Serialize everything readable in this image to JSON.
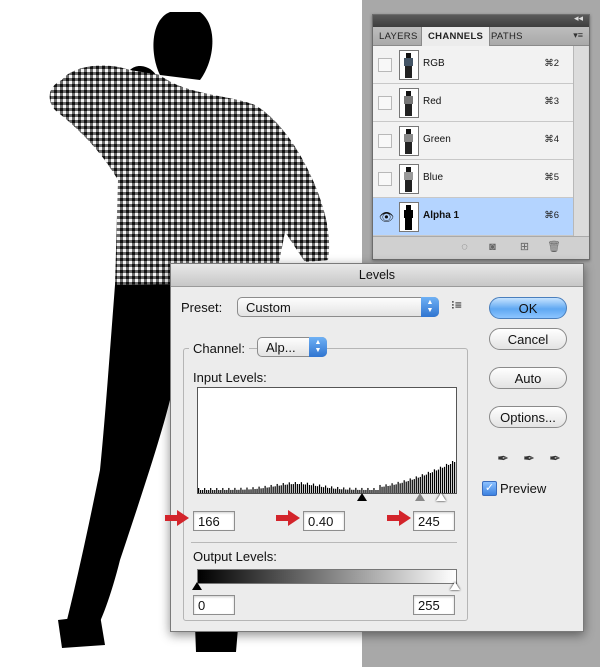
{
  "channels_panel": {
    "tabs": [
      "LAYERS",
      "CHANNELS",
      "PATHS"
    ],
    "active_tab": "CHANNELS",
    "rows": [
      {
        "name": "RGB",
        "shortcut": "⌘2",
        "visible": false,
        "selected": false
      },
      {
        "name": "Red",
        "shortcut": "⌘3",
        "visible": false,
        "selected": false
      },
      {
        "name": "Green",
        "shortcut": "⌘4",
        "visible": false,
        "selected": false
      },
      {
        "name": "Blue",
        "shortcut": "⌘5",
        "visible": false,
        "selected": false
      },
      {
        "name": "Alpha 1",
        "shortcut": "⌘6",
        "visible": true,
        "selected": true
      }
    ],
    "bottom_icons": [
      "dotted-circle-icon",
      "mask-icon",
      "new-channel-icon",
      "trash-icon"
    ]
  },
  "levels": {
    "title": "Levels",
    "preset_label": "Preset:",
    "preset_value": "Custom",
    "channel_label": "Channel:",
    "channel_value": "Alp...",
    "input_levels_label": "Input Levels:",
    "input_black": "166",
    "input_gamma": "0.40",
    "input_white": "245",
    "output_levels_label": "Output Levels:",
    "output_black": "0",
    "output_white": "255",
    "buttons": {
      "ok": "OK",
      "cancel": "Cancel",
      "auto": "Auto",
      "options": "Options..."
    },
    "preview_label": "Preview",
    "preview_checked": true,
    "histogram_max_level": 255
  },
  "colors": {
    "selection": "#b4d4ff",
    "dialog_bg": "#ececec",
    "red_arrow": "#d3242b",
    "ok_blue": "#5fa8f2"
  }
}
